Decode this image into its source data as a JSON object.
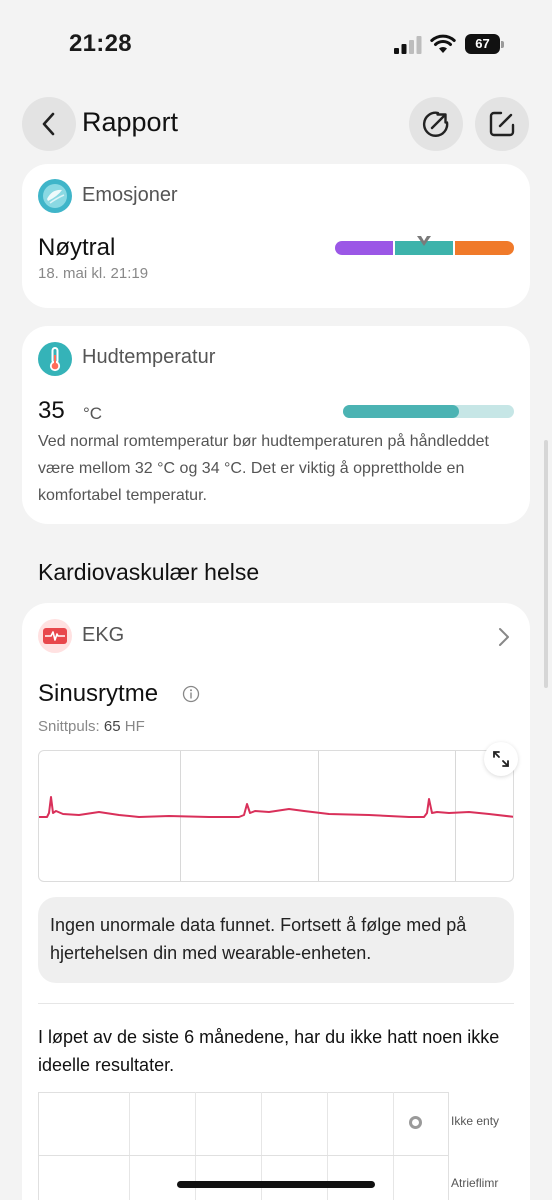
{
  "status_bar": {
    "time": "21:28",
    "battery": "67"
  },
  "header": {
    "title": "Rapport"
  },
  "emotions": {
    "title": "Emosjoner",
    "value": "Nøytral",
    "date": "18. mai kl. 21:19",
    "colors": {
      "low": "#9b57e6",
      "mid": "#3db3ab",
      "high": "#f07a2a"
    },
    "marker_position": 0.5
  },
  "skin_temp": {
    "title": "Hudtemperatur",
    "value": "35",
    "unit": "°C",
    "level": 0.68,
    "description": "Ved normal romtemperatur bør hudtemperaturen på håndleddet være mellom 32 °C og 34 °C. Det er viktig å opprettholde en komfortabel temperatur."
  },
  "cardio": {
    "section_title": "Kardiovaskulær helse",
    "ecg_title": "EKG",
    "rhythm": "Sinusrytme",
    "avg_pulse_label": "Snittpuls:",
    "avg_pulse_value": "65",
    "avg_pulse_unit": "HF",
    "info_text": "Ingen unormale data funnet. Fortsett å følge med på hjertehelsen din med wearable-enheten.",
    "summary": "I løpet av de siste 6 månedene, har du ikke hatt noen ikke ideelle resultater.",
    "chart_labels": [
      "Ikke enty",
      "Atrieflimr"
    ]
  }
}
